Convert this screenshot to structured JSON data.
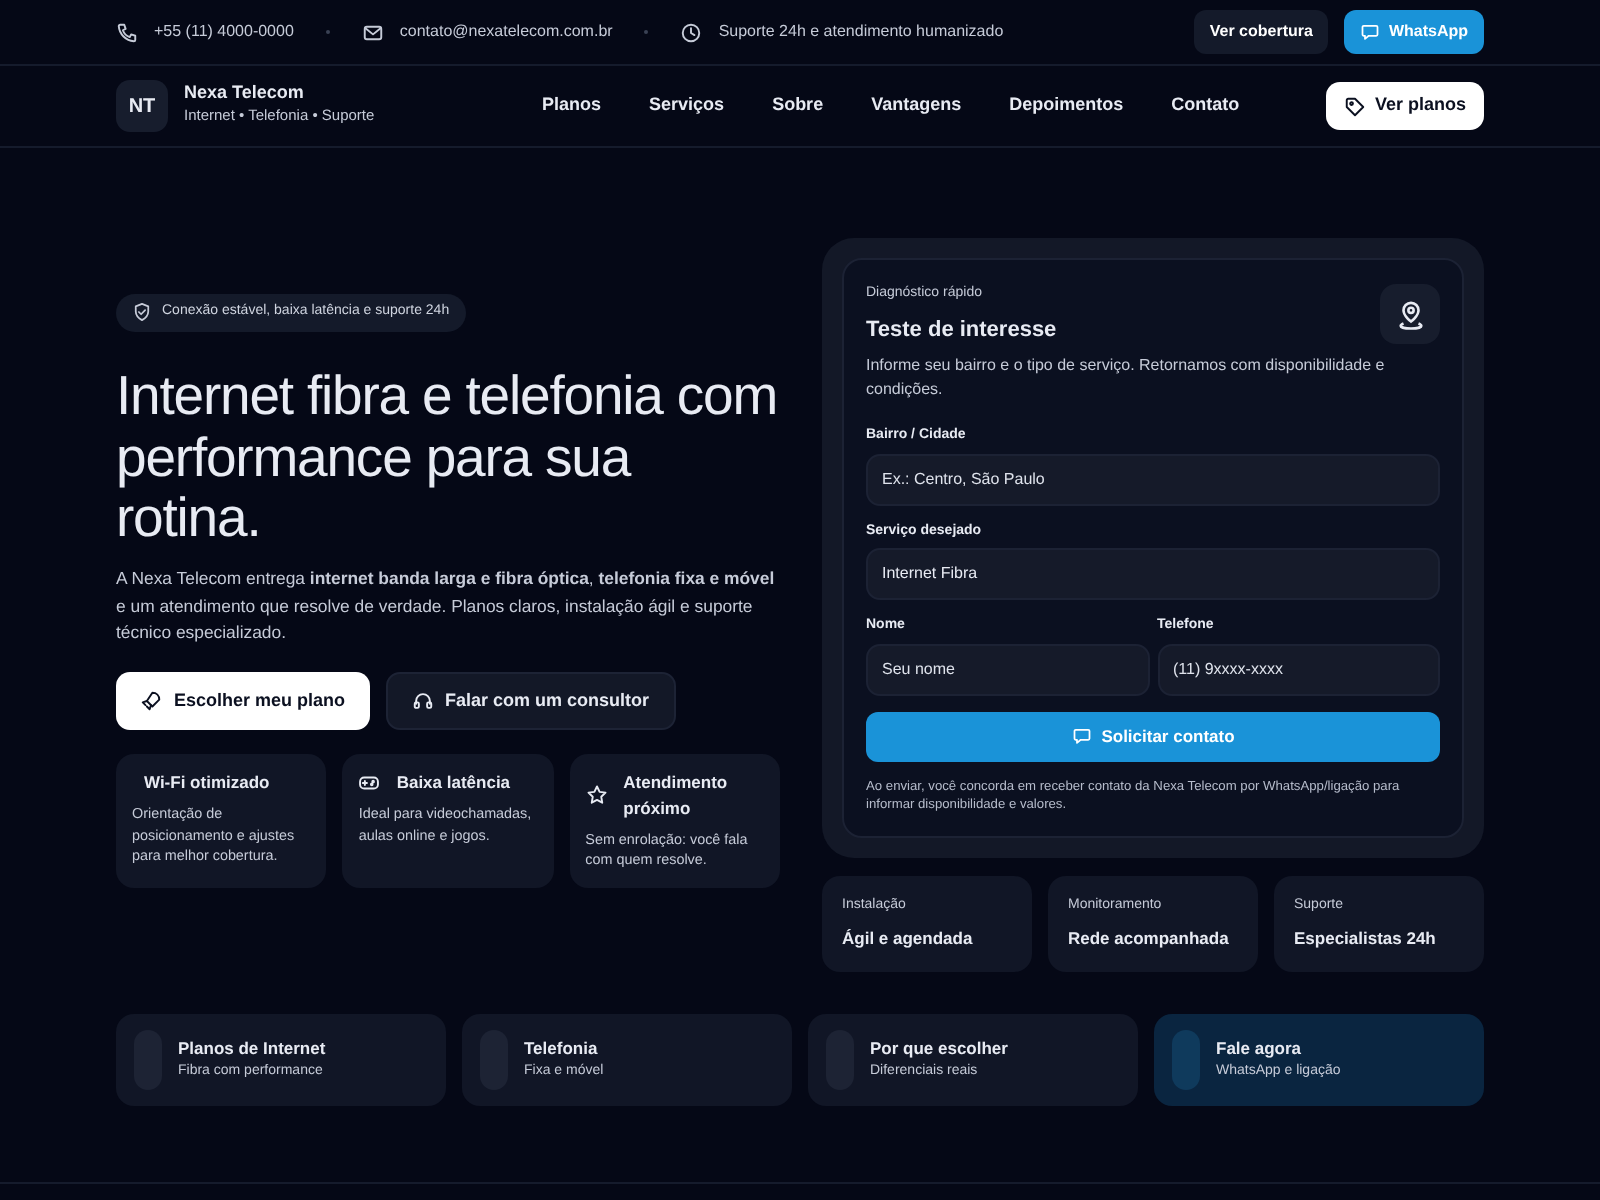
{
  "topbar": {
    "contacts": [
      {
        "kind": "phone",
        "text": "+55 (11) 4000-0000"
      },
      {
        "kind": "mail",
        "text": "contato@nexatelecom.com.br"
      },
      {
        "kind": "clock",
        "text": "Suporte 24h e atendimento humanizado"
      }
    ],
    "buttons": [
      {
        "kind": "dark",
        "label": "Ver cobertura"
      },
      {
        "kind": "primary",
        "label": "WhatsApp"
      }
    ]
  },
  "navbar": {
    "logo": "NT",
    "brand": "Nexa Telecom",
    "tagline": "Internet • Telefonia • Suporte",
    "links": [
      "Planos",
      "Serviços",
      "Sobre",
      "Vantagens",
      "Depoimentos",
      "Contato"
    ],
    "cta": "Ver planos"
  },
  "hero": {
    "badge": "Conexão estável, baixa latência e suporte 24h",
    "title": "Internet fibra e telefonia com performance para sua rotina.",
    "lead": "A Nexa Telecom entrega **internet banda larga e fibra óptica**, **telefonia fixa e móvel** e um atendimento que resolve de verdade. Planos claros, instalação ágil e suporte técnico especializado.",
    "buttons": [
      {
        "kind": "light",
        "label": "Escolher meu plano"
      },
      {
        "kind": "dark",
        "label": "Falar com um consultor"
      }
    ],
    "features": [
      {
        "kind": "plain",
        "title": "Wi-Fi otimizado",
        "text": "Orientação de posicionamento e ajustes para melhor cobertura."
      },
      {
        "kind": "gamepad",
        "title": "Baixa latência",
        "text": "Ideal para videochamadas, aulas online e jogos."
      },
      {
        "kind": "star",
        "title": "Atendimento próximo",
        "text": "Sem enrolação: você fala com quem resolve."
      }
    ]
  },
  "form": {
    "eyebrow": "Diagnóstico rápido",
    "title": "Teste de interesse",
    "intro": "Informe seu bairro e o tipo de serviço. Retornamos com disponibilidade e condições.",
    "fields": [
      {
        "kind": "input",
        "label": "Bairro / Cidade",
        "placeholder": "Ex.: Centro, São Paulo"
      },
      {
        "kind": "select",
        "label": "Serviço desejado",
        "value": "Internet Fibra"
      },
      {
        "kind": "input",
        "label": "Nome",
        "placeholder": "Seu nome"
      },
      {
        "kind": "input",
        "label": "Telefone",
        "placeholder": "(11) 9xxxx-xxxx"
      }
    ],
    "submit": "Solicitar contato",
    "note": "Ao enviar, você concorda em receber contato da Nexa Telecom por WhatsApp/ligação para informar disponibilidade e valores."
  },
  "stats": [
    {
      "label": "Instalação",
      "value": "Ágil e agendada"
    },
    {
      "label": "Monitoramento",
      "value": "Rede acompanhada"
    },
    {
      "label": "Suporte",
      "value": "Especialistas 24h"
    }
  ],
  "shortcuts": [
    {
      "kind": "default",
      "title": "Planos de Internet",
      "subtitle": "Fibra com performance"
    },
    {
      "kind": "default",
      "title": "Telefonia",
      "subtitle": "Fixa e móvel"
    },
    {
      "kind": "default",
      "title": "Por que escolher",
      "subtitle": "Diferenciais reais"
    },
    {
      "kind": "accent",
      "title": "Fale agora",
      "subtitle": "WhatsApp e ligação"
    }
  ]
}
